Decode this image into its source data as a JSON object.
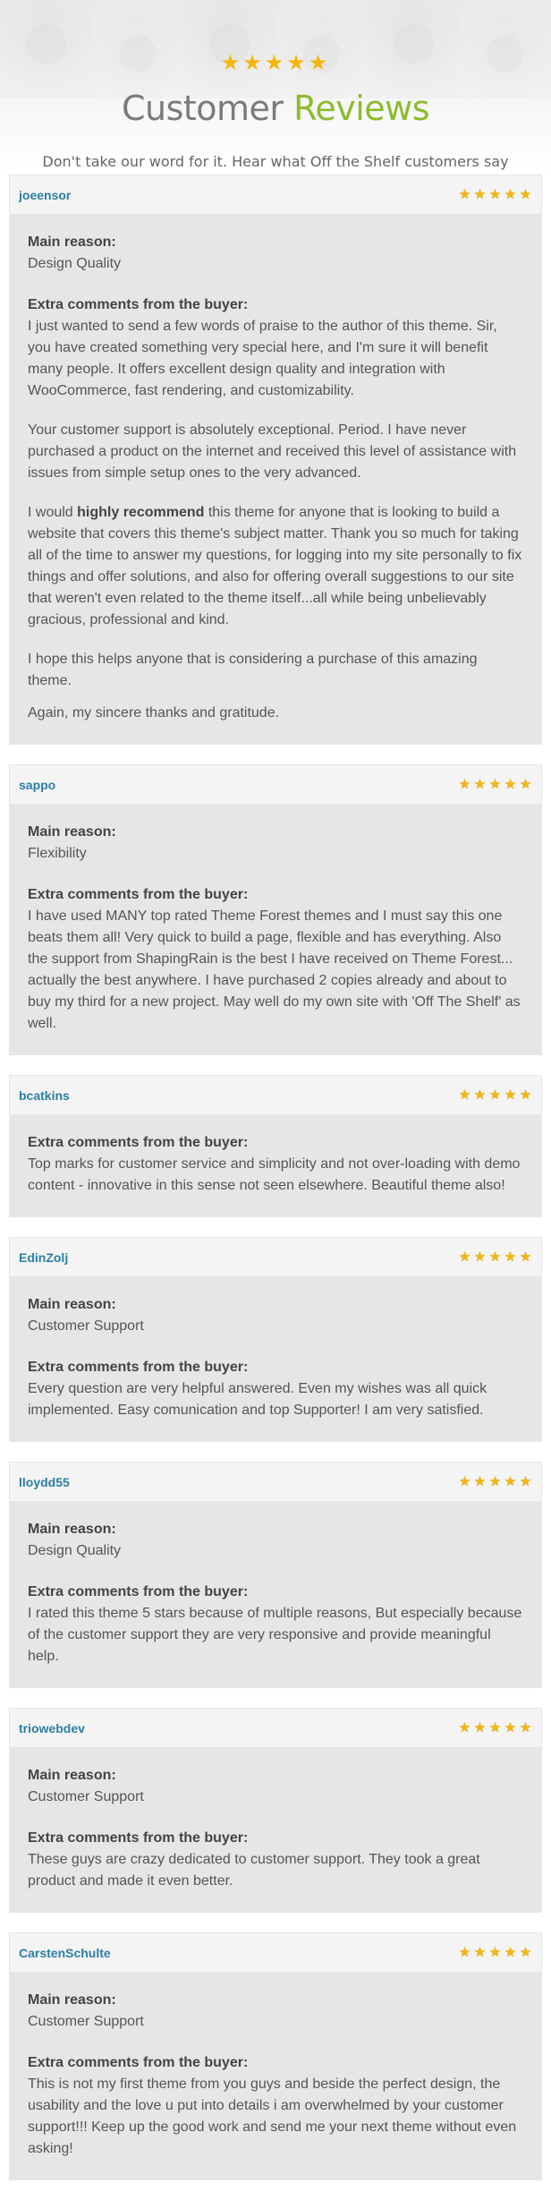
{
  "header": {
    "stars": "★★★★★",
    "title_main": "Customer ",
    "title_accent": "Reviews",
    "subtitle": "Don't take our word for it. Hear what Off the Shelf customers say"
  },
  "labels": {
    "main_reason": "Main reason:",
    "extra_comments": "Extra comments from the buyer:"
  },
  "rating_icon": "star-icon",
  "colors": {
    "accent_green": "#8dbb2f",
    "author_blue": "#2b7fa3",
    "star_gold": "#f3b70d"
  },
  "reviews": [
    {
      "author": "joeensor",
      "rating": 5,
      "main_reason": "Design Quality",
      "paragraphs": [
        "I just wanted to send a few words of praise to the author of this theme. Sir, you have created something very special here, and I'm sure it will benefit many people. It offers excellent design quality and integration with WooCommerce, fast rendering, and customizability.",
        "Your customer support is absolutely exceptional. Period. I have never purchased a product on the internet and received this level of assistance with issues from simple setup ones to the very advanced.",
        "I would highly recommend this theme for anyone that is looking to build a website that covers this theme's subject matter. Thank you so much for taking all of the time to answer my questions, for logging into my site personally to fix things and offer solutions, and also for offering overall suggestions to our site that weren't even related to the theme itself...all while being unbelievably gracious, professional and kind.",
        "I hope this helps anyone that is considering a purchase of this amazing theme.",
        "Again, my sincere thanks and gratitude."
      ]
    },
    {
      "author": "sappo",
      "rating": 5,
      "main_reason": "Flexibility",
      "paragraphs": [
        "I have used MANY top rated Theme Forest themes and I must say this one beats them all! Very quick to build a page, flexible and has everything. Also the support from ShapingRain is the best I have received on Theme Forest... actually the best anywhere. I have purchased 2 copies already and about to buy my third for a new project. May well do my own site with 'Off The Shelf' as well."
      ]
    },
    {
      "author": "bcatkins",
      "rating": 5,
      "main_reason": "",
      "paragraphs": [
        "Top marks for customer service and simplicity and not over-loading with demo content - innovative in this sense not seen elsewhere. Beautiful theme also!"
      ]
    },
    {
      "author": "EdinZolj",
      "rating": 5,
      "main_reason": "Customer Support",
      "paragraphs": [
        "Every question are very helpful answered. Even my wishes was all quick implemented. Easy comunication and top Supporter! I am very satisfied."
      ]
    },
    {
      "author": "lloydd55",
      "rating": 5,
      "main_reason": "Design Quality",
      "paragraphs": [
        "I rated this theme 5 stars because of multiple reasons, But especially because of the customer support they are very responsive and provide meaningful help."
      ]
    },
    {
      "author": "triowebdev",
      "rating": 5,
      "main_reason": "Customer Support",
      "paragraphs": [
        "These guys are crazy dedicated to customer support. They took a great product and made it even better."
      ]
    },
    {
      "author": "CarstenSchulte",
      "rating": 5,
      "main_reason": "Customer Support",
      "paragraphs": [
        "This is not my first theme from you guys and beside the perfect design, the usability and the love u put into details i am overwhelmed by your customer support!!! Keep up the good work and send me your next theme without even asking!"
      ]
    }
  ]
}
